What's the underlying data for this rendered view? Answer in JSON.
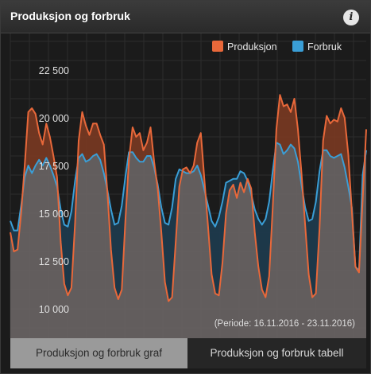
{
  "header": {
    "title": "Produksjon og forbruk",
    "info_icon": "i"
  },
  "tabs": [
    {
      "label": "Produksjon og forbruk graf",
      "active": true
    },
    {
      "label": "Produksjon og forbruk tabell",
      "active": false
    }
  ],
  "colors": {
    "produksjon": "#e8683a",
    "forbruk": "#3a9ed6",
    "background": "#1b1b1b",
    "grid": "#2c2c2c"
  },
  "chart_data": {
    "type": "line",
    "title": "Produksjon og forbruk",
    "period_label": "(Periode: 16.11.2016 - 23.11.2016)",
    "ylim": [
      9000,
      24000
    ],
    "yticks": [
      10000,
      12500,
      15000,
      17500,
      20000,
      22500
    ],
    "ytick_labels": [
      "10 000",
      "12 500",
      "15 000",
      "17 500",
      "20 000",
      "22 500"
    ],
    "legend_position": "top-right",
    "grid": true,
    "series": [
      {
        "name": "Produksjon",
        "color": "#e8683a",
        "points": [
          [
            0,
            14000
          ],
          [
            1,
            13000
          ],
          [
            2,
            13100
          ],
          [
            3,
            15000
          ],
          [
            4,
            17500
          ],
          [
            5,
            20300
          ],
          [
            6,
            20500
          ],
          [
            7,
            20200
          ],
          [
            8,
            19200
          ],
          [
            9,
            18600
          ],
          [
            10,
            19700
          ],
          [
            11,
            19000
          ],
          [
            12,
            18000
          ],
          [
            13,
            16900
          ],
          [
            14,
            13500
          ],
          [
            15,
            11300
          ],
          [
            16,
            10700
          ],
          [
            17,
            11100
          ],
          [
            18,
            14500
          ],
          [
            19,
            18800
          ],
          [
            20,
            20300
          ],
          [
            21,
            19600
          ],
          [
            22,
            19100
          ],
          [
            23,
            19700
          ],
          [
            24,
            19700
          ],
          [
            25,
            19100
          ],
          [
            26,
            18600
          ],
          [
            27,
            16100
          ],
          [
            28,
            13100
          ],
          [
            29,
            11100
          ],
          [
            30,
            10500
          ],
          [
            31,
            11000
          ],
          [
            32,
            14600
          ],
          [
            33,
            17800
          ],
          [
            34,
            19500
          ],
          [
            35,
            19000
          ],
          [
            36,
            19200
          ],
          [
            37,
            18300
          ],
          [
            38,
            18700
          ],
          [
            39,
            19500
          ],
          [
            40,
            17700
          ],
          [
            41,
            16300
          ],
          [
            42,
            14000
          ],
          [
            43,
            11400
          ],
          [
            44,
            10400
          ],
          [
            45,
            10600
          ],
          [
            46,
            13500
          ],
          [
            47,
            16400
          ],
          [
            48,
            17300
          ],
          [
            49,
            17400
          ],
          [
            50,
            17100
          ],
          [
            51,
            17500
          ],
          [
            52,
            18700
          ],
          [
            53,
            19200
          ],
          [
            54,
            16700
          ],
          [
            55,
            14300
          ],
          [
            56,
            11800
          ],
          [
            57,
            10800
          ],
          [
            58,
            10700
          ],
          [
            59,
            12400
          ],
          [
            60,
            15000
          ],
          [
            61,
            16200
          ],
          [
            62,
            16500
          ],
          [
            63,
            15800
          ],
          [
            64,
            16600
          ],
          [
            65,
            16100
          ],
          [
            66,
            16800
          ],
          [
            67,
            16300
          ],
          [
            68,
            14000
          ],
          [
            69,
            12200
          ],
          [
            70,
            11000
          ],
          [
            71,
            10600
          ],
          [
            72,
            11700
          ],
          [
            73,
            15300
          ],
          [
            74,
            19400
          ],
          [
            75,
            21200
          ],
          [
            76,
            20600
          ],
          [
            77,
            20700
          ],
          [
            78,
            20300
          ],
          [
            79,
            21000
          ],
          [
            80,
            19400
          ],
          [
            81,
            17100
          ],
          [
            82,
            14400
          ],
          [
            83,
            11800
          ],
          [
            84,
            10600
          ],
          [
            85,
            10800
          ],
          [
            86,
            14200
          ],
          [
            87,
            18800
          ],
          [
            88,
            20100
          ],
          [
            89,
            19700
          ],
          [
            90,
            19900
          ],
          [
            91,
            19800
          ],
          [
            92,
            20500
          ],
          [
            93,
            20000
          ],
          [
            94,
            18100
          ],
          [
            95,
            15100
          ],
          [
            96,
            12200
          ],
          [
            97,
            11900
          ],
          [
            98,
            15700
          ],
          [
            99,
            19400
          ]
        ]
      },
      {
        "name": "Forbruk",
        "color": "#3a9ed6",
        "points": [
          [
            0,
            14600
          ],
          [
            1,
            14100
          ],
          [
            2,
            14100
          ],
          [
            3,
            15400
          ],
          [
            4,
            16900
          ],
          [
            5,
            17500
          ],
          [
            6,
            17100
          ],
          [
            7,
            17500
          ],
          [
            8,
            17800
          ],
          [
            9,
            17500
          ],
          [
            10,
            17900
          ],
          [
            11,
            17500
          ],
          [
            12,
            17000
          ],
          [
            13,
            16400
          ],
          [
            14,
            15200
          ],
          [
            15,
            14400
          ],
          [
            16,
            14300
          ],
          [
            17,
            15100
          ],
          [
            18,
            16700
          ],
          [
            19,
            17900
          ],
          [
            20,
            18100
          ],
          [
            21,
            17700
          ],
          [
            22,
            17800
          ],
          [
            23,
            18000
          ],
          [
            24,
            18100
          ],
          [
            25,
            17800
          ],
          [
            26,
            17100
          ],
          [
            27,
            16200
          ],
          [
            28,
            15200
          ],
          [
            29,
            14400
          ],
          [
            30,
            14500
          ],
          [
            31,
            15400
          ],
          [
            32,
            16900
          ],
          [
            33,
            18200
          ],
          [
            34,
            18200
          ],
          [
            35,
            17900
          ],
          [
            36,
            17700
          ],
          [
            37,
            17700
          ],
          [
            38,
            18000
          ],
          [
            39,
            18000
          ],
          [
            40,
            17400
          ],
          [
            41,
            16500
          ],
          [
            42,
            15300
          ],
          [
            43,
            14500
          ],
          [
            44,
            14400
          ],
          [
            45,
            15300
          ],
          [
            46,
            16800
          ],
          [
            47,
            17300
          ],
          [
            48,
            17200
          ],
          [
            49,
            17100
          ],
          [
            50,
            17100
          ],
          [
            51,
            17200
          ],
          [
            52,
            17500
          ],
          [
            53,
            17000
          ],
          [
            54,
            16200
          ],
          [
            55,
            15400
          ],
          [
            56,
            14600
          ],
          [
            57,
            14300
          ],
          [
            58,
            14800
          ],
          [
            59,
            15600
          ],
          [
            60,
            16600
          ],
          [
            61,
            16700
          ],
          [
            62,
            16800
          ],
          [
            63,
            16800
          ],
          [
            64,
            17200
          ],
          [
            65,
            17100
          ],
          [
            66,
            16700
          ],
          [
            67,
            16000
          ],
          [
            68,
            15200
          ],
          [
            69,
            14700
          ],
          [
            70,
            14400
          ],
          [
            71,
            14700
          ],
          [
            72,
            15600
          ],
          [
            73,
            17200
          ],
          [
            74,
            18700
          ],
          [
            75,
            18600
          ],
          [
            76,
            18100
          ],
          [
            77,
            18300
          ],
          [
            78,
            18600
          ],
          [
            79,
            18400
          ],
          [
            80,
            17700
          ],
          [
            81,
            16500
          ],
          [
            82,
            15300
          ],
          [
            83,
            14600
          ],
          [
            84,
            14700
          ],
          [
            85,
            15600
          ],
          [
            86,
            17200
          ],
          [
            87,
            18300
          ],
          [
            88,
            18300
          ],
          [
            89,
            18000
          ],
          [
            90,
            17900
          ],
          [
            91,
            18000
          ],
          [
            92,
            18100
          ],
          [
            93,
            17400
          ],
          [
            94,
            16400
          ],
          [
            95,
            15300
          ],
          [
            96,
            12200
          ],
          [
            97,
            12000
          ],
          [
            98,
            17000
          ],
          [
            99,
            18300
          ]
        ]
      }
    ]
  }
}
